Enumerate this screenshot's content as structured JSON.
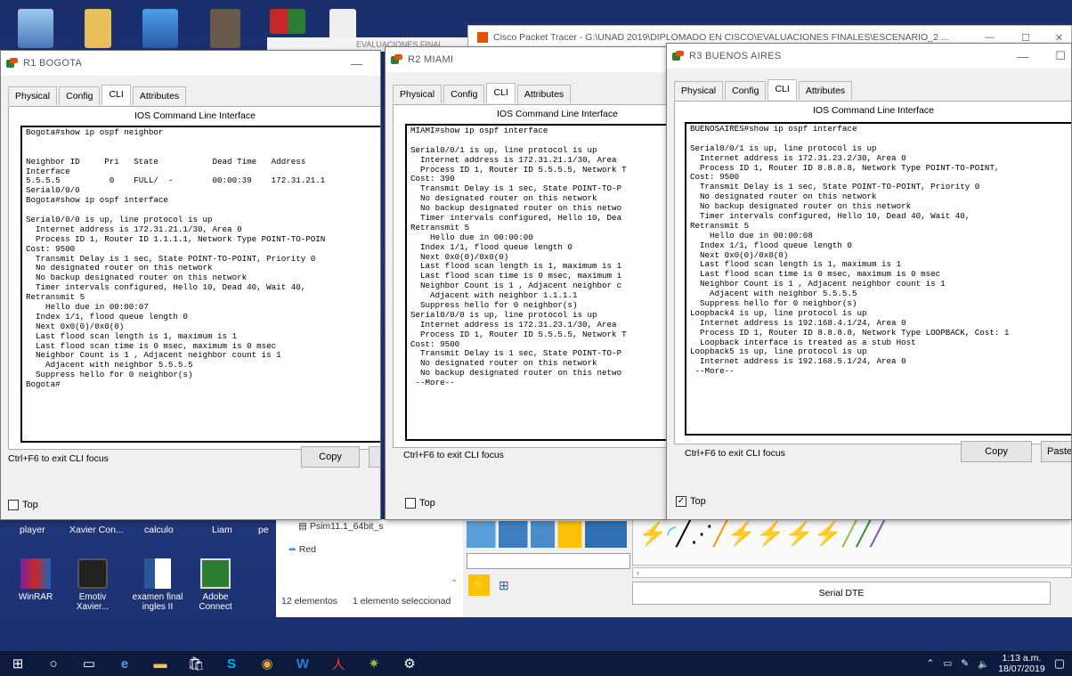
{
  "desktop_top_icons": [
    "recycle-bin-icon",
    "folder-icon",
    "network-icon",
    "photo-icon",
    "app-icon",
    "document-icon"
  ],
  "back_title": "Cisco Packet Tracer - G:\\UNAD 2019\\DIPLOMADO EN CISCO\\EVALUACIONES FINALES\\ESCENARIO_2 ...",
  "back_folder_title": "EVALUACIONES FINAL",
  "tabs": [
    "Physical",
    "Config",
    "CLI",
    "Attributes"
  ],
  "cli_header": "IOS Command Line Interface",
  "exit_hint": "Ctrl+F6 to exit CLI focus",
  "copy_label": "Copy",
  "paste_label": "Paste",
  "top_label": "Top",
  "r1": {
    "title": "R1   BOGOTA",
    "lines": [
      "Bogota#show ip ospf neighbor",
      "",
      "",
      "Neighbor ID     Pri   State           Dead Time   Address",
      "Interface",
      "5.5.5.5          0    FULL/  -        00:00:39    172.31.21.1",
      "Serial0/0/0",
      "Bogota#show ip ospf interface",
      "",
      "Serial0/0/0 is up, line protocol is up",
      "  Internet address is 172.31.21.1/30, Area 0",
      "  Process ID 1, Router ID 1.1.1.1, Network Type POINT-TO-POIN",
      "Cost: 9500",
      "  Transmit Delay is 1 sec, State POINT-TO-POINT, Priority 0",
      "  No designated router on this network",
      "  No backup designated router on this network",
      "  Timer intervals configured, Hello 10, Dead 40, Wait 40,",
      "Retransmit 5",
      "    Hello due in 00:00:07",
      "  Index 1/1, flood queue length 0",
      "  Next 0x0(0)/0x0(0)",
      "  Last flood scan length is 1, maximum is 1",
      "  Last flood scan time is 0 msec, maximum is 0 msec",
      "  Neighbor Count is 1 , Adjacent neighbor count is 1",
      "    Adjacent with neighbor 5.5.5.5",
      "  Suppress hello for 0 neighbor(s)",
      "Bogota#"
    ]
  },
  "r2": {
    "title": "R2   MIAMI",
    "lines": [
      "MIAMI#show ip ospf interface",
      "",
      "Serial0/0/1 is up, line protocol is up",
      "  Internet address is 172.31.21.1/30, Area",
      "  Process ID 1, Router ID 5.5.5.5, Network T",
      "Cost: 390",
      "  Transmit Delay is 1 sec, State POINT-TO-P",
      "  No designated router on this network",
      "  No backup designated router on this netwo",
      "  Timer intervals configured, Hello 10, Dea",
      "Retransmit 5",
      "    Hello due in 00:00:00",
      "  Index 1/1, flood queue length 0",
      "  Next 0x0(0)/0x0(0)",
      "  Last flood scan length is 1, maximum is 1",
      "  Last flood scan time is 0 msec, maximum i",
      "  Neighbor Count is 1 , Adjacent neighbor c",
      "    Adjacent with neighbor 1.1.1.1",
      "  Suppress hello for 0 neighbor(s)",
      "Serial0/0/0 is up, line protocol is up",
      "  Internet address is 172.31.23.1/30, Area",
      "  Process ID 1, Router ID 5.5.5.5, Network T",
      "Cost: 9500",
      "  Transmit Delay is 1 sec, State POINT-TO-P",
      "  No designated router on this network",
      "  No backup designated router on this netwo",
      " --More--"
    ]
  },
  "r3": {
    "title": "R3   BUENOS AIRES",
    "lines": [
      "BUENOSAIRES#show ip ospf interface",
      "",
      "Serial0/0/1 is up, line protocol is up",
      "  Internet address is 172.31.23.2/30, Area 0",
      "  Process ID 1, Router ID 8.8.8.8, Network Type POINT-TO-POINT,",
      "Cost: 9500",
      "  Transmit Delay is 1 sec, State POINT-TO-POINT, Priority 0",
      "  No designated router on this network",
      "  No backup designated router on this network",
      "  Timer intervals configured, Hello 10, Dead 40, Wait 40,",
      "Retransmit 5",
      "    Hello due in 00:00:08",
      "  Index 1/1, flood queue length 0",
      "  Next 0x0(0)/0x0(0)",
      "  Last flood scan length is 1, maximum is 1",
      "  Last flood scan time is 0 msec, maximum is 0 msec",
      "  Neighbor Count is 1 , Adjacent neighbor count is 1",
      "    Adjacent with neighbor 5.5.5.5",
      "  Suppress hello for 0 neighbor(s)",
      "Loopback4 is up, line protocol is up",
      "  Internet address is 192.168.4.1/24, Area 0",
      "  Process ID 1, Router ID 8.8.8.8, Network Type LOOPBACK, Cost: 1",
      "  Loopback interface is treated as a stub Host",
      "Loopback5 is up, line protocol is up",
      "  Internet address is 192.168.5.1/24, Area 0",
      " --More--"
    ]
  },
  "desktop_labels": [
    "player",
    "Xavier Con...",
    "calculo",
    "Liam",
    "pe"
  ],
  "desktop_icons": [
    {
      "label": "WinRAR",
      "icon": "winrar-icon"
    },
    {
      "label": "Emotiv Xavier...",
      "icon": "emotiv-icon"
    },
    {
      "label": "examen final ingles II",
      "icon": "word-doc-icon"
    },
    {
      "label": "Adobe Connect",
      "icon": "adobe-connect-icon"
    }
  ],
  "explorer": {
    "file1": "Psim11.1_64bit_s",
    "file2": "Red",
    "count": "12 elementos",
    "selected": "1 elemento seleccionad"
  },
  "pt_conn_label": "Serial DTE",
  "taskbar_icons": [
    "windows-start-icon",
    "search-icon",
    "task-view-icon",
    "edge-icon",
    "file-explorer-icon",
    "store-icon",
    "skype-icon",
    "chrome-icon",
    "word-icon",
    "acrobat-icon",
    "packet-tracer-icon",
    "settings-icon"
  ],
  "tray": {
    "time": "1:13 a.m.",
    "date": "18/07/2019"
  }
}
